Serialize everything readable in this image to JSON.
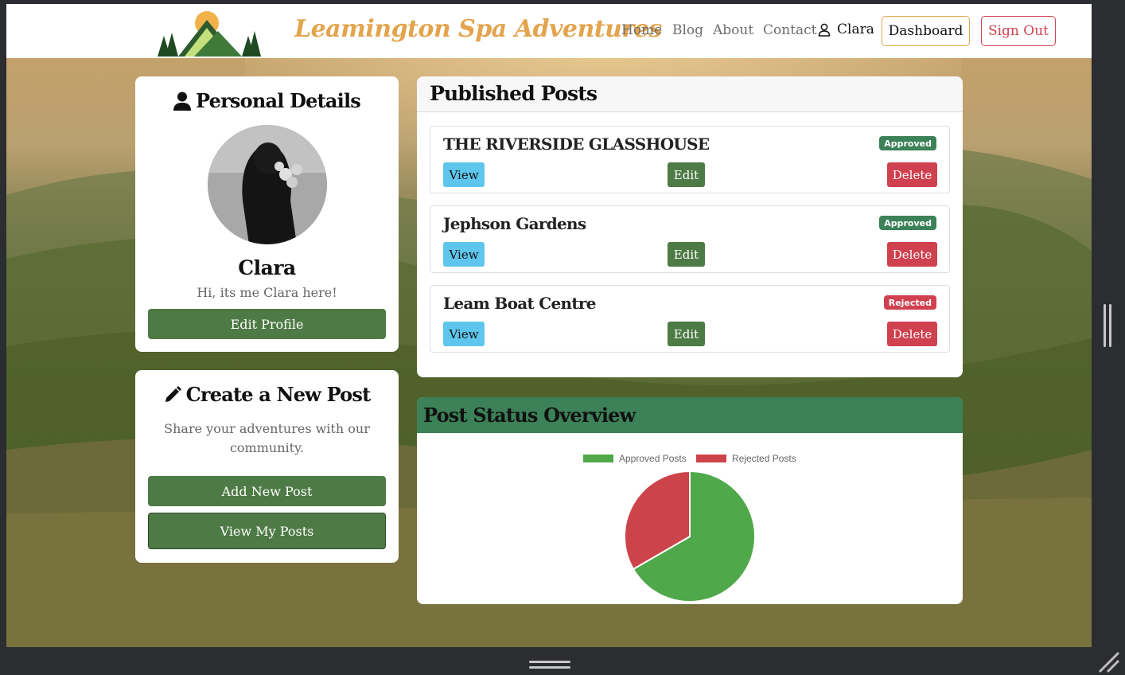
{
  "navbar": {
    "brand": "Leamington Spa Adventures",
    "links": [
      "Home",
      "Blog",
      "About",
      "Contact"
    ],
    "user_name": "Clara",
    "dashboard_label": "Dashboard",
    "signout_label": "Sign Out"
  },
  "personal": {
    "title": "Personal Details",
    "name": "Clara",
    "bio": "Hi, its me Clara here!",
    "edit_label": "Edit Profile"
  },
  "new_post": {
    "title": "Create a New Post",
    "description": "Share your adventures with our community.",
    "add_label": "Add New Post",
    "view_label": "View My Posts"
  },
  "published": {
    "title": "Published Posts",
    "posts": [
      {
        "title": "THE RIVERSIDE GLASSHOUSE",
        "status": "Approved",
        "view": "View",
        "edit": "Edit",
        "delete": "Delete"
      },
      {
        "title": "Jephson Gardens",
        "status": "Approved",
        "view": "View",
        "edit": "Edit",
        "delete": "Delete"
      },
      {
        "title": "Leam Boat Centre",
        "status": "Rejected",
        "view": "View",
        "edit": "Edit",
        "delete": "Delete"
      }
    ]
  },
  "status_overview": {
    "title": "Post Status Overview"
  },
  "colors": {
    "approved": "#4fa84a",
    "rejected": "#cc4449",
    "brand": "#e3a44d",
    "primary_green": "#4e7a45",
    "header_green": "#3c8157",
    "info": "#5ec6ec",
    "danger": "#d0414f"
  },
  "chart_data": {
    "type": "pie",
    "categories": [
      "Approved Posts",
      "Rejected Posts"
    ],
    "values": [
      2,
      1
    ],
    "legend_position": "top"
  }
}
